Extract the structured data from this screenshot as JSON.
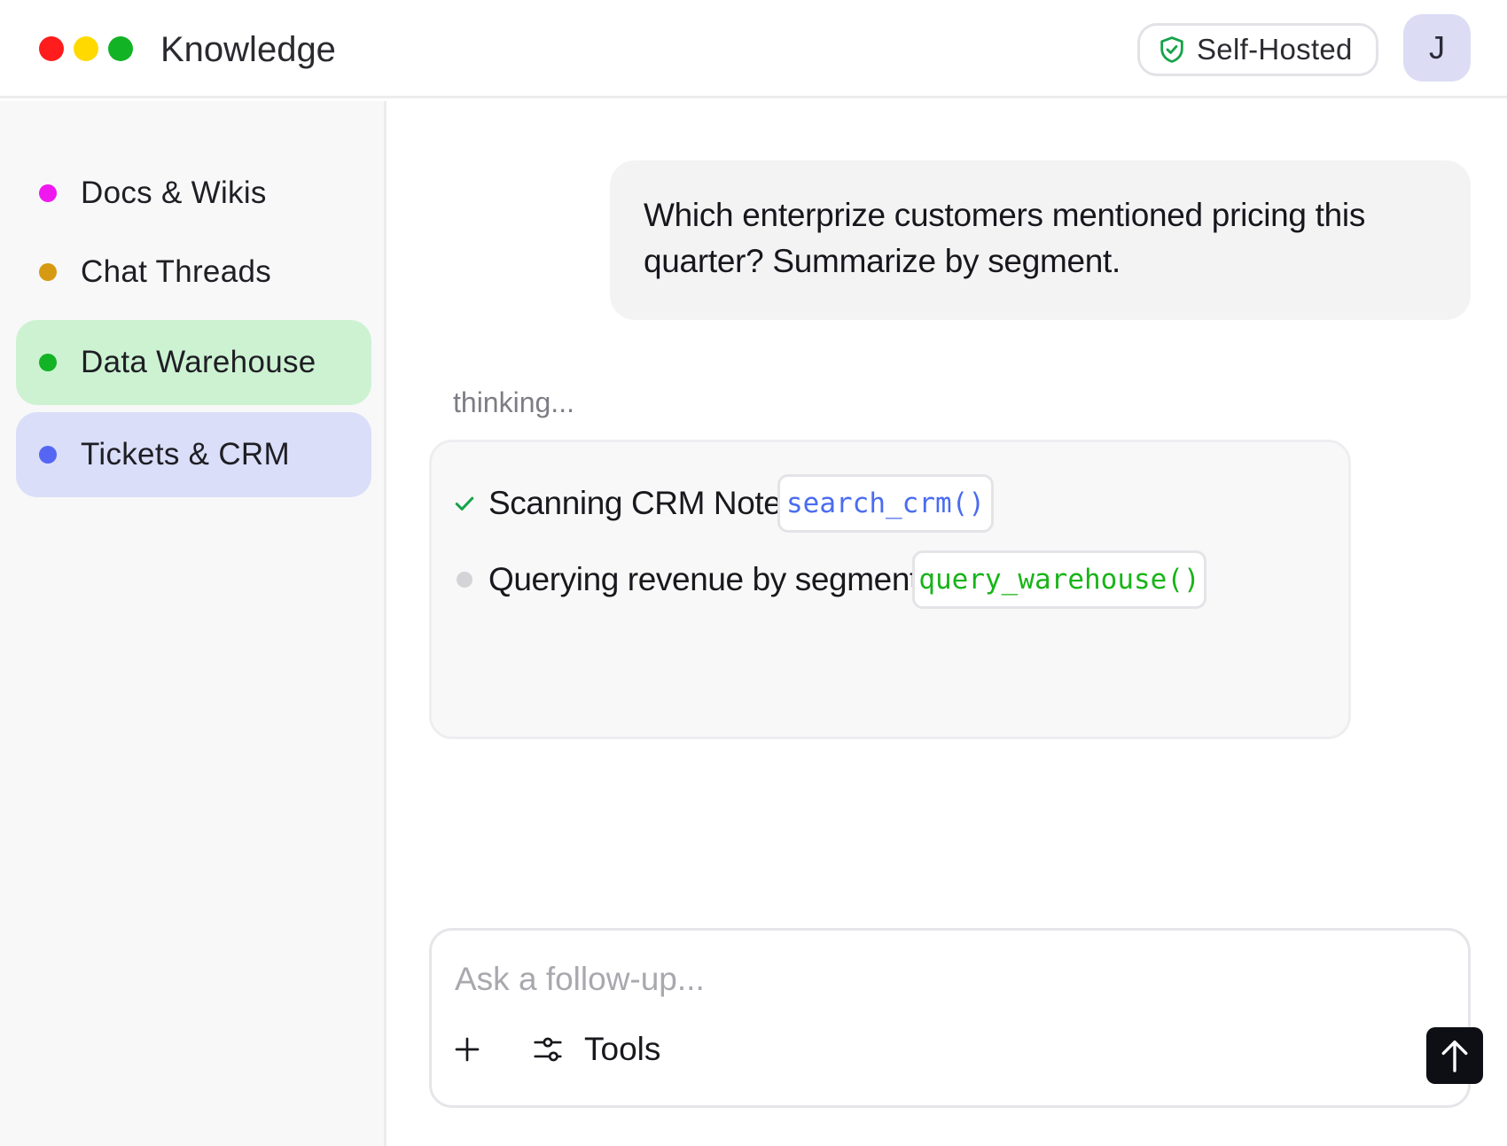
{
  "window": {
    "title": "Knowledge",
    "controls": {
      "close_color": "#ff1c1c",
      "minimize_color": "#ffd900",
      "maximize_color": "#12b324"
    }
  },
  "header": {
    "badge": {
      "label": "Self-Hosted",
      "icon": "shield-check-icon",
      "icon_color": "#16a34a"
    },
    "avatar": {
      "initial": "J",
      "background": "#dcdcf5"
    }
  },
  "sidebar": {
    "items": [
      {
        "label": "Docs & Wikis",
        "dot_color": "#ef18ef",
        "state": "default"
      },
      {
        "label": "Chat Threads",
        "dot_color": "#d69a12",
        "state": "default"
      },
      {
        "label": "Data Warehouse",
        "dot_color": "#12b324",
        "state": "highlighted-green"
      },
      {
        "label": "Tickets & CRM",
        "dot_color": "#5566f2",
        "state": "highlighted-blue"
      }
    ]
  },
  "conversation": {
    "user_message": "Which enterprize customers mentioned pricing this quarter? Summarize by segment.",
    "status": "thinking...",
    "steps": [
      {
        "label": "Scanning CRM Notes",
        "status": "done",
        "tool": "search_crm()",
        "tool_color": "#4a6cf0"
      },
      {
        "label": "Querying revenue by segment",
        "status": "pending",
        "tool": "query_warehouse()",
        "tool_color": "#18b418"
      }
    ]
  },
  "composer": {
    "placeholder": "Ask a follow-up...",
    "value": "",
    "tools_label": "Tools",
    "add_icon": "plus-icon",
    "tools_icon": "sliders-icon",
    "send_icon": "arrow-up-icon"
  }
}
